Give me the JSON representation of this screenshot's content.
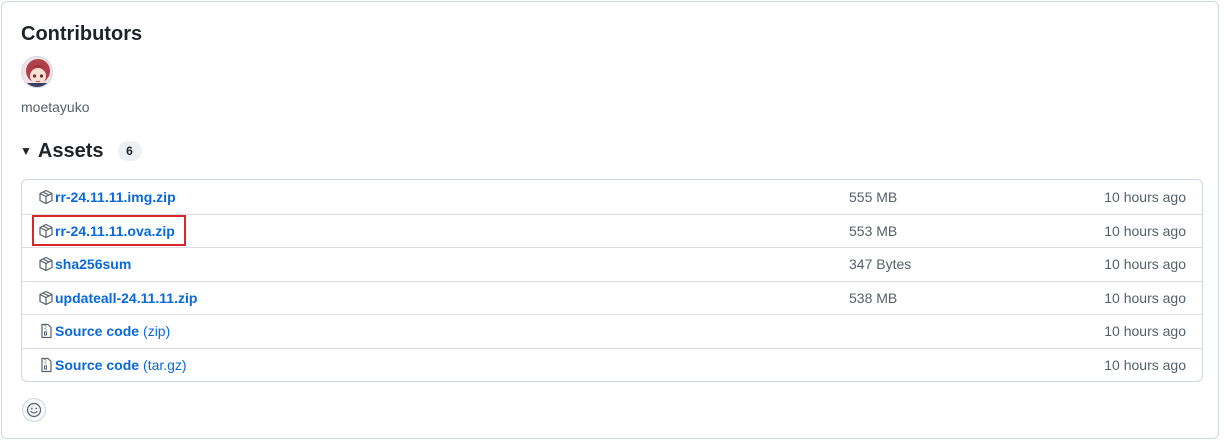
{
  "contributors": {
    "title": "Contributors",
    "username": "moetayuko"
  },
  "assets": {
    "title": "Assets",
    "count": "6",
    "items": [
      {
        "name": "rr-24.11.11.img.zip",
        "suffix": "",
        "size": "555 MB",
        "time": "10 hours ago",
        "icon": "package-icon"
      },
      {
        "name": "rr-24.11.11.ova.zip",
        "suffix": "",
        "size": "553 MB",
        "time": "10 hours ago",
        "icon": "package-icon",
        "highlighted": true
      },
      {
        "name": "sha256sum",
        "suffix": "",
        "size": "347 Bytes",
        "time": "10 hours ago",
        "icon": "package-icon"
      },
      {
        "name": "updateall-24.11.11.zip",
        "suffix": "",
        "size": "538 MB",
        "time": "10 hours ago",
        "icon": "package-icon"
      },
      {
        "name": "Source code",
        "suffix": "(zip)",
        "size": "",
        "time": "10 hours ago",
        "icon": "file-zip-icon"
      },
      {
        "name": "Source code",
        "suffix": "(tar.gz)",
        "size": "",
        "time": "10 hours ago",
        "icon": "file-zip-icon"
      }
    ]
  },
  "colors": {
    "link": "#0969da",
    "muted": "#57606a",
    "border": "#d0d7de",
    "highlight": "#d9262b"
  },
  "icons": {
    "caret": "triangle-down-icon",
    "reaction": "smiley-icon"
  }
}
